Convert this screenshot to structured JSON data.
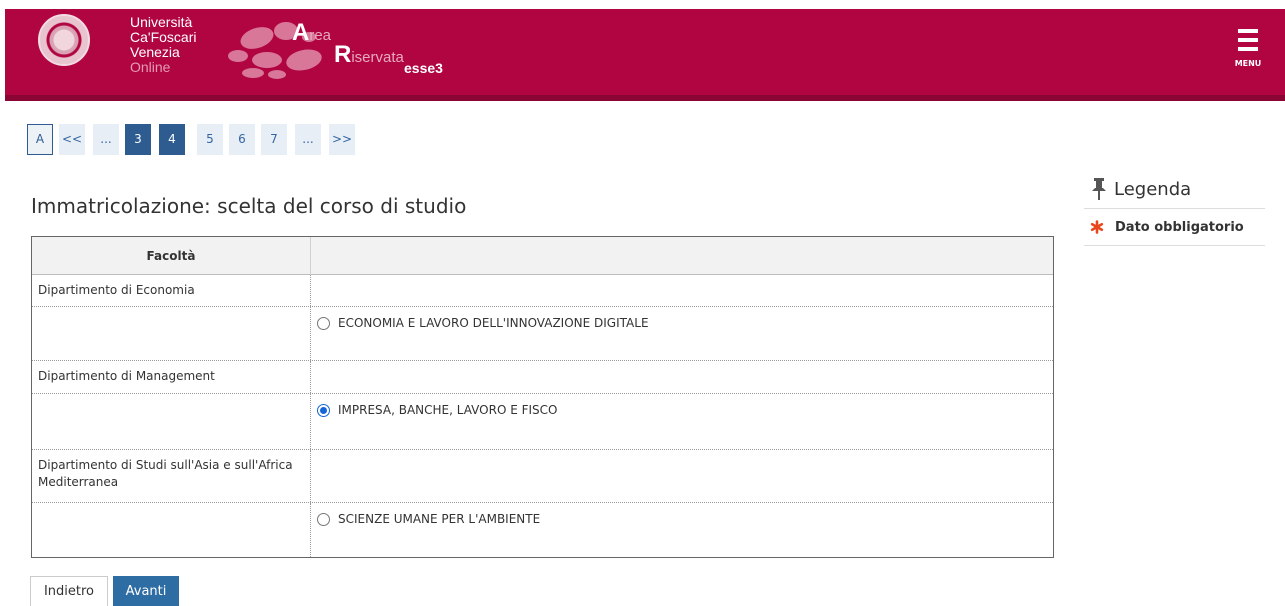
{
  "header": {
    "univ_line1": "Università",
    "univ_line2": "Ca'Foscari",
    "univ_line3": "Venezia",
    "univ_line4": "Online",
    "area_a": "A",
    "area_rest": "rea",
    "riservata_r": "R",
    "riservata_rest": "iservata",
    "esse3": "esse3",
    "menu_label": "MENU",
    "brand_color": "#b10542"
  },
  "pagination": {
    "items": [
      "A",
      "<<",
      "...",
      "3",
      "4",
      "5",
      "6",
      "7",
      "...",
      ">>"
    ],
    "current": "4"
  },
  "page_title": "Immatricolazione: scelta del corso di studio",
  "table": {
    "header_col1": "Facoltà",
    "header_col2": "",
    "rows": [
      {
        "department": "Dipartimento di Economia",
        "course": "ECONOMIA E LAVORO DELL'INNOVAZIONE DIGITALE",
        "selected": false
      },
      {
        "department": "Dipartimento di Management",
        "course": "IMPRESA, BANCHE, LAVORO E FISCO",
        "selected": true
      },
      {
        "department": "Dipartimento di Studi sull'Asia e sull'Africa Mediterranea",
        "course": "SCIENZE UMANE PER L'AMBIENTE",
        "selected": false
      }
    ]
  },
  "buttons": {
    "back": "Indietro",
    "next": "Avanti"
  },
  "legend": {
    "title": "Legenda",
    "required_label": "Dato obbligatorio",
    "pin_icon": "pin-icon",
    "star_icon": "asterisk-icon",
    "star_color": "#e8481c"
  }
}
